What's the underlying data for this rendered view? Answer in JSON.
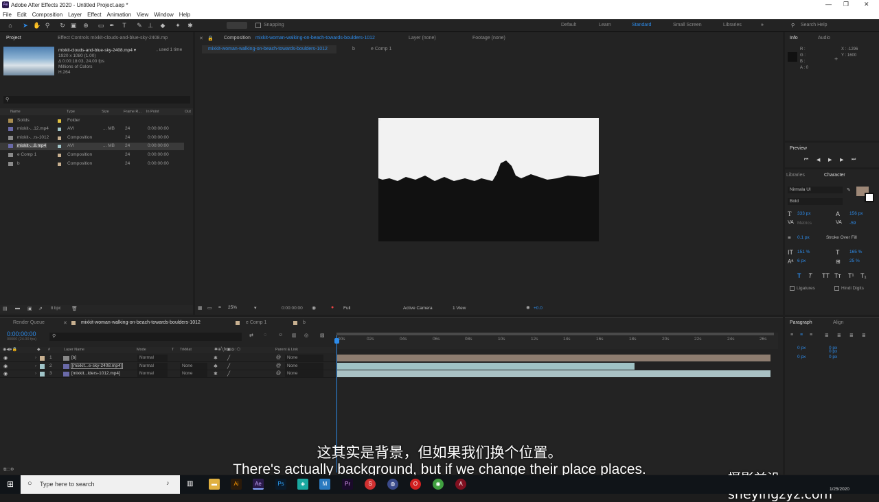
{
  "window": {
    "title": "Adobe After Effects 2020 - Untitled Project.aep *",
    "app_badge": "Ae"
  },
  "menu": [
    "File",
    "Edit",
    "Composition",
    "Layer",
    "Effect",
    "Animation",
    "View",
    "Window",
    "Help"
  ],
  "toolbar": {
    "snapping": "Snapping",
    "workspaces": [
      "Default",
      "Learn",
      "Standard",
      "Small Screen",
      "Libraries"
    ],
    "active_workspace": "Standard",
    "search_placeholder": "Search Help"
  },
  "project": {
    "tab": "Project",
    "effect_controls_tab": "Effect Controls mixkit-clouds-and-blue-sky-2408.mp",
    "file_name": "mixkit-clouds-and-blue-sky-2408.mp4 ▾",
    "used": ", used 1 time",
    "info_lines": [
      "1920 x 1080 (1.00)",
      "Δ 0:00:18:03, 24.00 fps",
      "Millions of Colors",
      "H.264"
    ],
    "columns": [
      "Name",
      "Type",
      "Size",
      "Frame R...",
      "In Point",
      "Out"
    ],
    "items": [
      {
        "name": "Solids",
        "type": "Folder",
        "size": "",
        "fps": "",
        "in": ""
      },
      {
        "name": "mixkit-...12.mp4",
        "type": "AVI",
        "size": "... MB",
        "fps": "24",
        "in": "0:00:00:00"
      },
      {
        "name": "mixkit-...rs-1012",
        "type": "Composition",
        "size": "",
        "fps": "24",
        "in": "0:00:00:00"
      },
      {
        "name": "mixkit-...8.mp4",
        "type": "AVI",
        "size": "... MB",
        "fps": "24",
        "in": "0:00:00:00"
      },
      {
        "name": "e Comp 1",
        "type": "Composition",
        "size": "",
        "fps": "24",
        "in": "0:00:00:00"
      },
      {
        "name": "b",
        "type": "Composition",
        "size": "",
        "fps": "24",
        "in": "0:00:00:00"
      }
    ],
    "bpc": "8 bpc"
  },
  "comp": {
    "tab_prefix": "Composition",
    "tab_name": "mixkit-woman-walking-on-beach-towards-boulders-1012",
    "layer_tab": "Layer (none)",
    "footage_tab": "Footage (none)",
    "breadcrumb": [
      "mixkit-woman-walking-on-beach-towards-boulders-1012",
      "b",
      "e Comp 1"
    ],
    "zoom": "25%",
    "timecode": "0:00:00:00",
    "resolution": "Full",
    "camera": "Active Camera",
    "views": "1 View",
    "exposure": "+0.0"
  },
  "info": {
    "tab": "Info",
    "audio_tab": "Audio",
    "r": "R :",
    "g": "G :",
    "b": "B :",
    "a": "A : 0",
    "x": "X : -1296",
    "y": "Y : 1600"
  },
  "preview": {
    "tab": "Preview"
  },
  "character": {
    "libraries_tab": "Libraries",
    "tab": "Character",
    "font": "Nirmala UI",
    "style": "Bold",
    "size": "333 px",
    "leading": "156 px",
    "kerning": "Metrics",
    "tracking": "-59",
    "stroke": "0.1 px",
    "stroke_mode": "Stroke Over Fill",
    "vscale": "151 %",
    "hscale": "165 %",
    "baseline": "6 px",
    "tsume": "25 %",
    "ligatures": "Ligatures",
    "hindi": "Hindi Digits"
  },
  "paragraph": {
    "tab": "Paragraph",
    "align_tab": "Align",
    "indents": [
      "0 px",
      "0 px",
      "0 px",
      "0 px",
      "0 px"
    ]
  },
  "timeline": {
    "render_queue": "Render Queue",
    "tabs": [
      "mixkit-woman-walking-on-beach-towards-boulders-1012",
      "e Comp 1",
      "b"
    ],
    "timecode": "0:00:00:00",
    "frame_info": "00000 (24.00 fps)",
    "columns": {
      "layer_name": "Layer Name",
      "mode": "Mode",
      "t": "T",
      "trkmat": "TrkMat",
      "parent": "Parent & Link"
    },
    "ruler": [
      "00s",
      "02s",
      "04s",
      "06s",
      "08s",
      "10s",
      "12s",
      "14s",
      "16s",
      "18s",
      "20s",
      "22s",
      "24s",
      "26s"
    ],
    "layers": [
      {
        "num": "1",
        "name": "[b]",
        "mode": "Normal",
        "trkmat": "",
        "parent": "None"
      },
      {
        "num": "2",
        "name": "[mixkit...e-sky-2408.mp4]",
        "mode": "Normal",
        "trkmat": "None",
        "parent": "None"
      },
      {
        "num": "3",
        "name": "[mixkit...lders-1012.mp4]",
        "mode": "Normal",
        "trkmat": "None",
        "parent": "None"
      }
    ]
  },
  "subtitles": {
    "cn": "这其实是背景，但如果我们换个位置。",
    "en": "There's actually background, but if we change their place places."
  },
  "watermark": "摄影前沿 sheyingzyz.com",
  "taskbar": {
    "search_placeholder": "Type here to search",
    "date": "1/25/2020"
  },
  "colors": {
    "accent": "#2d8ceb",
    "layer_b": "#8e7d70",
    "layer_sky": "#9fc2c4",
    "layer_beach": "#a9c1c4",
    "panel": "#232323",
    "bg": "#1d1d1d"
  }
}
